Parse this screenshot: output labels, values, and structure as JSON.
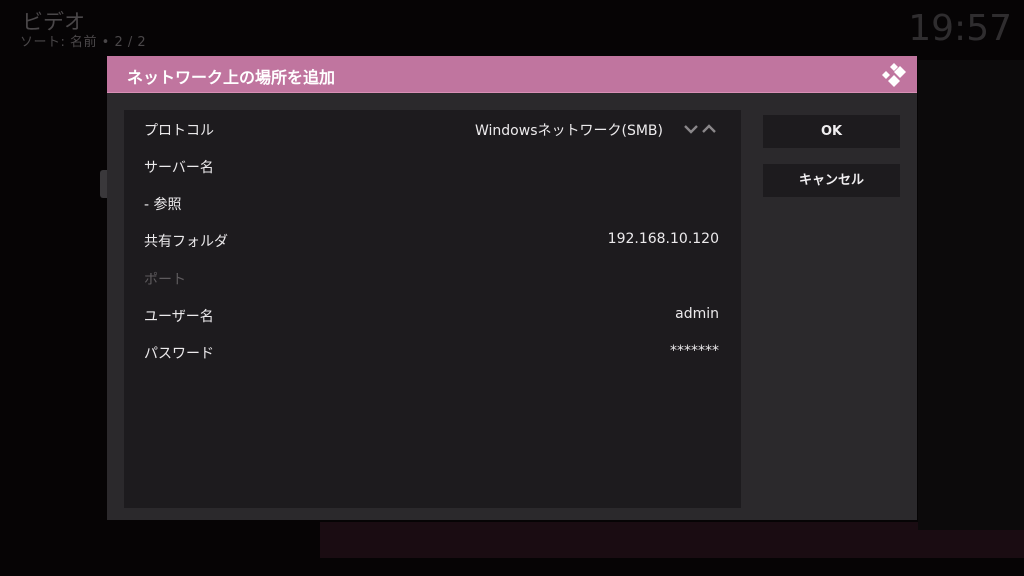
{
  "background": {
    "title": "ビデオ",
    "subtitle": "ソート: 名前 • 2 / 2",
    "clock": "19:57"
  },
  "dialog": {
    "title": "ネットワーク上の場所を追加",
    "header_color": "#c0759f",
    "logo_icon": "kodi-logo-icon",
    "fields": [
      {
        "label": "プロトコル",
        "value": "Windowsネットワーク(SMB)",
        "has_spinner": true,
        "enabled": true
      },
      {
        "label": "サーバー名",
        "value": "",
        "has_spinner": false,
        "enabled": true
      },
      {
        "label": "- 参照",
        "value": "",
        "has_spinner": false,
        "enabled": true
      },
      {
        "label": "共有フォルダ",
        "value": "192.168.10.120",
        "has_spinner": false,
        "enabled": true
      },
      {
        "label": "ポート",
        "value": "",
        "has_spinner": false,
        "enabled": false
      },
      {
        "label": "ユーザー名",
        "value": "admin",
        "has_spinner": false,
        "enabled": true
      },
      {
        "label": "パスワード",
        "value": "*******",
        "has_spinner": false,
        "enabled": true
      }
    ],
    "ok_label": "OK",
    "cancel_label": "キャンセル"
  }
}
